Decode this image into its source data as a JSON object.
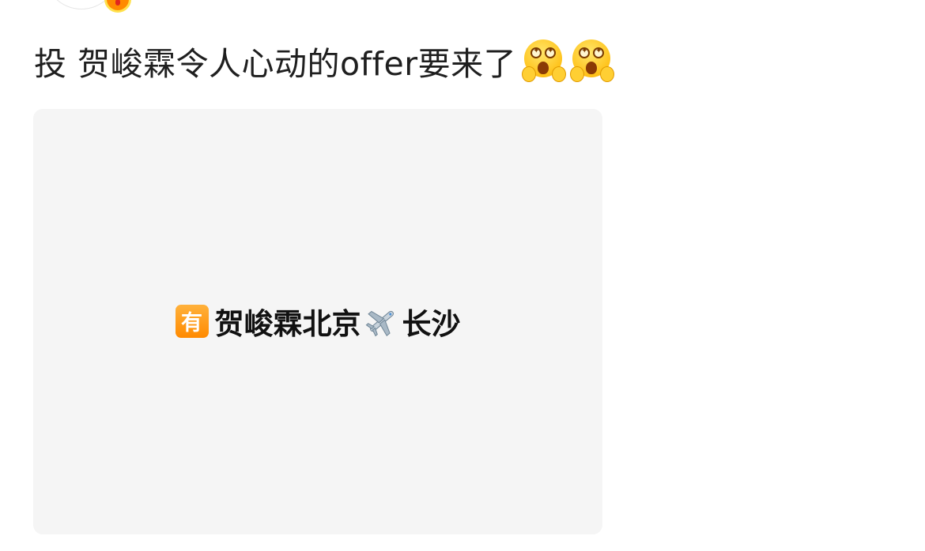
{
  "post": {
    "text": "投 贺峻霖令人心动的offer要来了",
    "emojis": [
      "grinning-face-with-star-eyes",
      "grinning-face-with-star-eyes"
    ]
  },
  "media": {
    "badge_char": "有",
    "text_before": "贺峻霖北京",
    "text_after": "长沙",
    "icon_between": "airplane-icon",
    "background": "#f5f5f5"
  },
  "colors": {
    "badge_orange": "#ff8a00",
    "text": "#1f1f1f"
  }
}
